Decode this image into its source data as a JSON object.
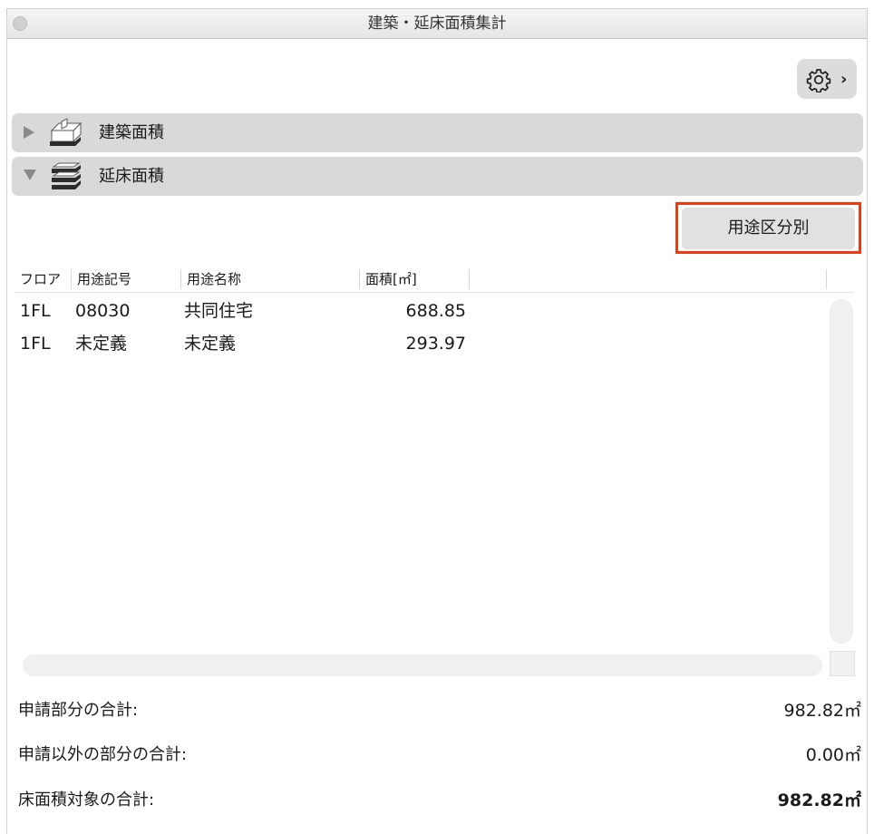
{
  "window": {
    "title": "建築・延床面積集計"
  },
  "sections": [
    {
      "label": "建築面積",
      "expanded": false
    },
    {
      "label": "延床面積",
      "expanded": true
    }
  ],
  "usage_button": {
    "label": "用途区分別"
  },
  "table": {
    "columns": [
      "フロア",
      "用途記号",
      "用途名称",
      "面積[㎡]"
    ],
    "rows": [
      [
        "1FL",
        "08030",
        "共同住宅",
        "688.85"
      ],
      [
        "1FL",
        "未定義",
        "未定義",
        "293.97"
      ]
    ]
  },
  "totals": [
    {
      "label": "申請部分の合計:",
      "value": "982.82㎡"
    },
    {
      "label": "申請以外の部分の合計:",
      "value": "0.00㎡"
    },
    {
      "label": "床面積対象の合計:",
      "value": "982.82㎡"
    }
  ],
  "colors": {
    "highlight": "#f2380f",
    "section_bg": "#d9d9d9"
  }
}
